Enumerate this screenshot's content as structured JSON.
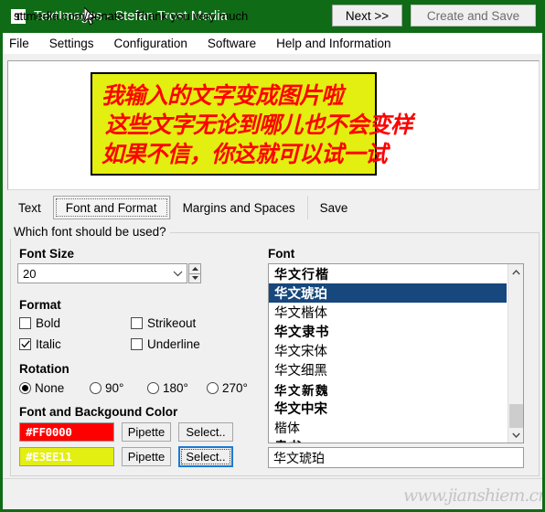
{
  "window": {
    "title": "TextImages - Stefan Trost Media",
    "icon": "app-t-icon",
    "titlebar_color": "#0f6b16",
    "minimize_label": "minimize-icon",
    "maximize_label": "maximize-icon",
    "close_label": "close-icon"
  },
  "menubar": {
    "items": [
      {
        "label": "File"
      },
      {
        "label": "Settings"
      },
      {
        "label": "Configuration"
      },
      {
        "label": "Software"
      },
      {
        "label": "Help and Information"
      }
    ]
  },
  "preview": {
    "image_background": "#E3EE11",
    "image_text_color": "#FF0000",
    "lines": [
      "我输入的文字变成图片啦",
      "这些文字无论到哪儿也不会变样",
      "如果不信，你这就可以试一试"
    ]
  },
  "tabs": [
    {
      "label": "Text",
      "selected": false
    },
    {
      "label": "Font and Format",
      "selected": true
    },
    {
      "label": "Margins and Spaces",
      "selected": false
    },
    {
      "label": "Save",
      "selected": false
    }
  ],
  "group": {
    "legend": "Which font should be used?"
  },
  "font_size": {
    "label": "Font Size",
    "value": "20",
    "spin_up": "spin-up-icon",
    "spin_down": "spin-down-icon"
  },
  "format": {
    "label": "Format",
    "options": [
      {
        "label": "Bold",
        "checked": false
      },
      {
        "label": "Strikeout",
        "checked": false
      },
      {
        "label": "Italic",
        "checked": true
      },
      {
        "label": "Underline",
        "checked": false
      }
    ]
  },
  "rotation": {
    "label": "Rotation",
    "options": [
      {
        "label": "None",
        "selected": true
      },
      {
        "label": "90°",
        "selected": false
      },
      {
        "label": "180°",
        "selected": false
      },
      {
        "label": "270°",
        "selected": false
      }
    ]
  },
  "colors": {
    "label": "Font and Backgound Color",
    "font": {
      "value": "#FF0000",
      "swatch": "#FF0000",
      "pipette_label": "Pipette",
      "select_label": "Select..",
      "focused": false
    },
    "background": {
      "value": "#E3EE11",
      "swatch": "#E3EE11",
      "pipette_label": "Pipette",
      "select_label": "Select..",
      "focused": true
    }
  },
  "font_panel": {
    "label": "Font",
    "items": [
      {
        "name": "华文行楷",
        "style": "st-kai",
        "selected": false
      },
      {
        "name": "华文琥珀",
        "style": "st-zhong",
        "selected": true
      },
      {
        "name": "华文楷体",
        "style": "st-song",
        "selected": false
      },
      {
        "name": "华文隶书",
        "style": "st-li",
        "selected": false
      },
      {
        "name": "华文宋体",
        "style": "st-song",
        "selected": false
      },
      {
        "name": "华文细黑",
        "style": "st-hei",
        "selected": false
      },
      {
        "name": "华文新魏",
        "style": "st-wei",
        "selected": false
      },
      {
        "name": "华文中宋",
        "style": "st-zhong",
        "selected": false
      },
      {
        "name": "楷体",
        "style": "st-light",
        "selected": false
      },
      {
        "name": "隶书",
        "style": "st-li",
        "selected": false
      }
    ],
    "selected_font_name": "华文琥珀",
    "scroll_up_icon": "chevron-up-icon",
    "scroll_down_icon": "chevron-down-icon"
  },
  "footer": {
    "donate_text": "sttmedia.com/donate - Thank you very much",
    "next_label": "Next >>",
    "create_label": "Create and Save",
    "watermark": "www.jianshiem.cn"
  }
}
